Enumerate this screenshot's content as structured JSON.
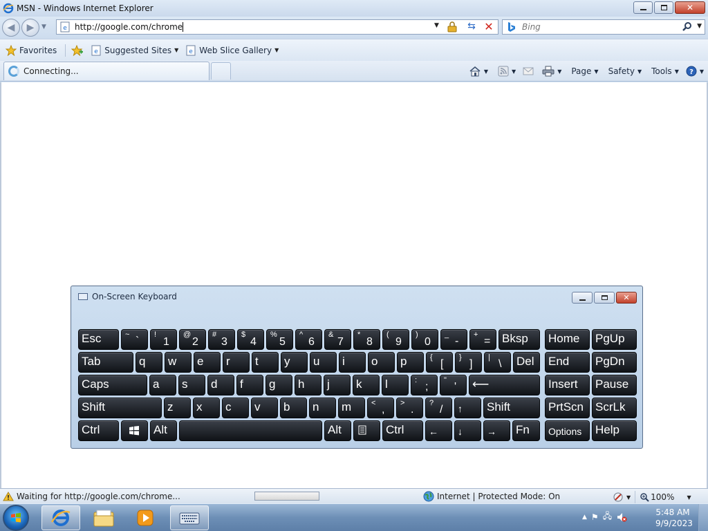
{
  "window": {
    "title": "MSN - Windows Internet Explorer"
  },
  "address_bar": {
    "url": "http://google.com/chrome"
  },
  "search": {
    "placeholder": "Bing"
  },
  "favorites_bar": {
    "favorites_label": "Favorites",
    "items": [
      {
        "label": "Suggested Sites"
      },
      {
        "label": "Web Slice Gallery"
      }
    ]
  },
  "tab": {
    "label": "Connecting..."
  },
  "command_bar": {
    "page_label": "Page",
    "safety_label": "Safety",
    "tools_label": "Tools"
  },
  "status_bar": {
    "status_text": "Waiting for http://google.com/chrome...",
    "progress": 0.0,
    "zone_text": "Internet | Protected Mode: On",
    "zoom": "100%"
  },
  "osk": {
    "title": "On-Screen Keyboard",
    "keys": {
      "esc": "Esc",
      "grave": {
        "shift": "~",
        "base": "`"
      },
      "n1": {
        "shift": "!",
        "base": "1"
      },
      "n2": {
        "shift": "@",
        "base": "2"
      },
      "n3": {
        "shift": "#",
        "base": "3"
      },
      "n4": {
        "shift": "$",
        "base": "4"
      },
      "n5": {
        "shift": "%",
        "base": "5"
      },
      "n6": {
        "shift": "^",
        "base": "6"
      },
      "n7": {
        "shift": "&",
        "base": "7"
      },
      "n8": {
        "shift": "*",
        "base": "8"
      },
      "n9": {
        "shift": "(",
        "base": "9"
      },
      "n0": {
        "shift": ")",
        "base": "0"
      },
      "minus": {
        "shift": "_",
        "base": "-"
      },
      "equals": {
        "shift": "+",
        "base": "="
      },
      "bksp": "Bksp",
      "home": "Home",
      "pgup": "PgUp",
      "tab": "Tab",
      "q": "q",
      "w": "w",
      "e": "e",
      "r": "r",
      "t": "t",
      "y": "y",
      "u": "u",
      "i": "i",
      "o": "o",
      "p": "p",
      "lbracket": {
        "shift": "{",
        "base": "["
      },
      "rbracket": {
        "shift": "}",
        "base": "]"
      },
      "backslash": {
        "shift": "|",
        "base": "\\"
      },
      "del": "Del",
      "end": "End",
      "pgdn": "PgDn",
      "caps": "Caps",
      "a": "a",
      "s": "s",
      "d": "d",
      "f": "f",
      "g": "g",
      "h": "h",
      "j": "j",
      "k": "k",
      "l": "l",
      "semicolon": {
        "shift": ":",
        "base": ";"
      },
      "quote": {
        "shift": "\"",
        "base": "'"
      },
      "enter": "⟵",
      "insert": "Insert",
      "pause": "Pause",
      "lshift": "Shift",
      "z": "z",
      "x": "x",
      "c": "c",
      "v": "v",
      "b": "b",
      "n": "n",
      "m": "m",
      "comma": {
        "shift": "<",
        "base": ","
      },
      "period": {
        "shift": ">",
        "base": "."
      },
      "slash": {
        "shift": "?",
        "base": "/"
      },
      "up": "↑",
      "rshift": "Shift",
      "prtscn": "PrtScn",
      "scrlk": "ScrLk",
      "lctrl": "Ctrl",
      "lalt": "Alt",
      "ralt": "Alt",
      "rctrl": "Ctrl",
      "left": "←",
      "down": "↓",
      "right": "→",
      "fn": "Fn",
      "options": "Options",
      "help": "Help"
    }
  },
  "taskbar": {
    "time": "5:48 AM",
    "date": "9/9/2023"
  },
  "colors": {
    "key_bg": "#15181d",
    "title_bg": "#cad9ec",
    "close_red": "#c2422c"
  }
}
